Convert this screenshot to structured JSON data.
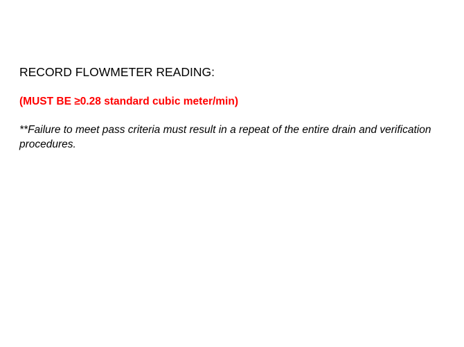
{
  "document": {
    "heading": "RECORD FLOWMETER READING:",
    "requirement": "(MUST BE ≥0.28 standard cubic meter/min)",
    "note": "**Failure to meet pass criteria must result in a repeat of the entire drain and verification procedures."
  },
  "colors": {
    "background": "#ffffff",
    "text": "#000000",
    "requirement_text": "#ff0000"
  }
}
